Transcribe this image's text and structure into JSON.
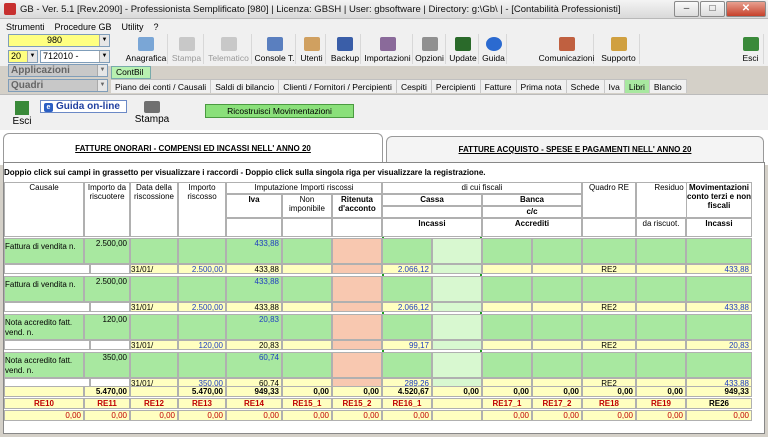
{
  "window": {
    "title": "GB - Ver. 5.1 [Rev.2090] - Professionista Semplificato [980]    | Licenza: GBSH | User: gbsoftware | Directory: g:\\Gb\\ | - [Contabilità Professionisti]"
  },
  "menu": [
    "Strumenti",
    "Procedure GB",
    "Utility",
    "?"
  ],
  "toolbar": {
    "combo1": "980",
    "combo2a": "20",
    "combo2b": "712010 -",
    "combo_app": "Applicazioni",
    "combo_quadri": "Quadri",
    "buttons": [
      "Anagrafica",
      "Stampa",
      "Telematico",
      "Console T.",
      "Utenti",
      "Backup",
      "Importazioni",
      "Opzioni",
      "Update",
      "Guida",
      "Comunicazioni",
      "Supporto",
      "Esci"
    ]
  },
  "tabs_top": [
    "ContBil"
  ],
  "tabs_second": [
    "Piano dei conti / Causali",
    "Saldi di bilancio",
    "Clienti / Fornitori / Percipienti",
    "Cespiti",
    "Percipienti",
    "Fatture",
    "Prima nota",
    "Schede",
    "Iva",
    "Libri",
    "Blancio"
  ],
  "actions": {
    "esci": "Esci",
    "guida": "Guida on-line",
    "stampa": "Stampa",
    "ricostruisci": "Ricostruisci Movimentazioni"
  },
  "bigtabs": [
    "FATTURE ONORARI - COMPENSI ED INCASSI NELL' ANNO 20",
    "FATTURE ACQUISTO - SPESE E PAGAMENTI NELL' ANNO 20"
  ],
  "instructions": "Doppio click sui campi in grassetto per visualizzare i raccordi -  Doppio click sulla singola riga per visualizzare la registrazione.",
  "headers": {
    "causale": "Causale",
    "importo": "Importo da riscuotere",
    "data": "Data della riscossione",
    "importo_risc": "Importo riscosso",
    "imputazione": "Imputazione Importi riscossi",
    "iva": "Iva",
    "non_imp": "Non imponibile",
    "ritenuta": "Ritenuta d'acconto",
    "dicui": "di cui fiscali",
    "cassa": "Cassa",
    "incassi": "Incassi",
    "banca": "Banca",
    "cc": "c/c",
    "accrediti": "Accrediti",
    "quadro": "Quadro RE",
    "residuo": "Residuo",
    "da_riscuot": "da riscuot.",
    "mov": "Movimentazioni conto terzi e non fiscali",
    "incassi2": "Incassi"
  },
  "rows": [
    {
      "causale": "Fattura di vendita n.",
      "importo": "2.500,00",
      "iva": "433,88",
      "data": "31/01/",
      "importo_risc": "2.500,00",
      "iva2": "433,88",
      "cassa": "2.066,12",
      "quadro": "RE2",
      "mov": "433,88"
    },
    {
      "causale": "Fattura di vendita n.",
      "importo": "2.500,00",
      "iva": "433,88",
      "data": "31/01/",
      "importo_risc": "2.500,00",
      "iva2": "433,88",
      "cassa": "2.066,12",
      "quadro": "RE2",
      "mov": "433,88"
    },
    {
      "causale": "Nota accredito fatt. vend. n.",
      "importo": "120,00",
      "iva": "20,83",
      "data": "31/01/",
      "importo_risc": "120,00",
      "iva2": "20,83",
      "cassa": "99,17",
      "quadro": "RE2",
      "mov": "20,83"
    },
    {
      "causale": "Nota accredito fatt. vend. n.",
      "importo": "350,00",
      "iva": "60,74",
      "data": "31/01/",
      "importo_risc": "350,00",
      "iva2": "60,74",
      "cassa": "289,26",
      "quadro": "RE2",
      "mov": "433,88"
    }
  ],
  "totals": [
    "5.470,00",
    "5.470,00",
    "949,33",
    "0,00",
    "0,00",
    "4.520,67",
    "0,00",
    "0,00",
    "0,00",
    "0,00",
    "0,00",
    "949,33"
  ],
  "codes": [
    "RE10",
    "RE11",
    "RE12",
    "RE13",
    "RE14",
    "RE15_1",
    "RE15_2",
    "RE16_1",
    "RE17_1",
    "RE17_2",
    "RE18",
    "RE19",
    "RE26"
  ],
  "zeros": [
    "0,00",
    "0,00",
    "0,00",
    "0,00",
    "0,00",
    "0,00",
    "0,00",
    "0,00",
    "0,00",
    "0,00",
    "0,00",
    "0,00",
    "0,00"
  ]
}
